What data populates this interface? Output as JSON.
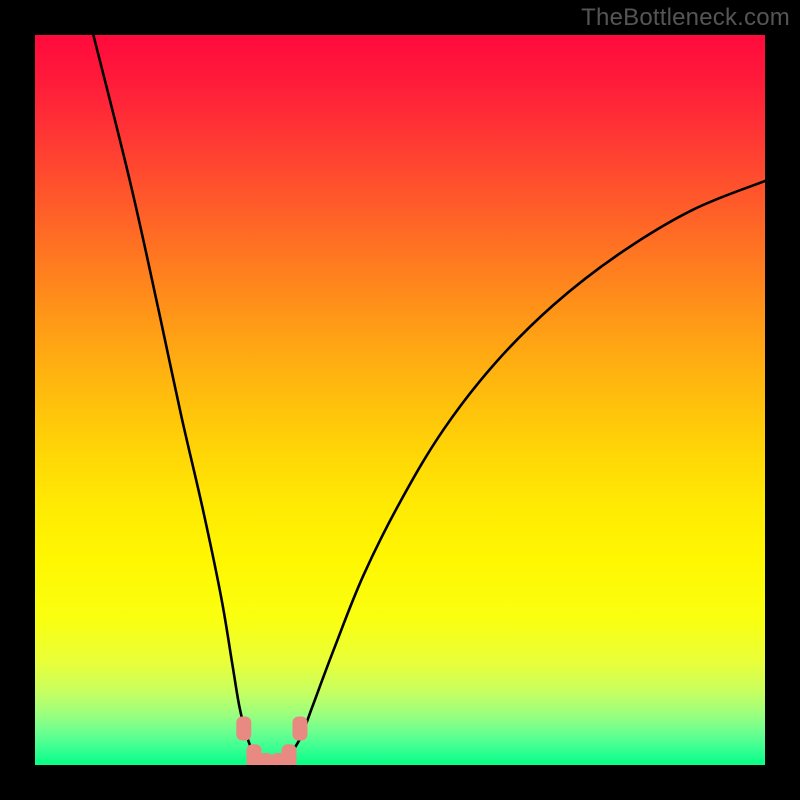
{
  "watermark": "TheBottleneck.com",
  "chart_data": {
    "type": "line",
    "title": "",
    "xlabel": "",
    "ylabel": "",
    "xlim": [
      0,
      100
    ],
    "ylim": [
      0,
      100
    ],
    "grid": false,
    "curve_points": [
      {
        "x": 8.0,
        "y": 100.0
      },
      {
        "x": 13.0,
        "y": 80.0
      },
      {
        "x": 17.0,
        "y": 62.0
      },
      {
        "x": 20.0,
        "y": 48.0
      },
      {
        "x": 23.0,
        "y": 35.0
      },
      {
        "x": 25.5,
        "y": 23.0
      },
      {
        "x": 27.0,
        "y": 14.0
      },
      {
        "x": 28.0,
        "y": 8.0
      },
      {
        "x": 29.0,
        "y": 4.0
      },
      {
        "x": 30.0,
        "y": 1.5
      },
      {
        "x": 31.0,
        "y": 0.3
      },
      {
        "x": 32.5,
        "y": 0.0
      },
      {
        "x": 34.0,
        "y": 0.3
      },
      {
        "x": 35.0,
        "y": 1.5
      },
      {
        "x": 36.5,
        "y": 4.0
      },
      {
        "x": 38.0,
        "y": 8.0
      },
      {
        "x": 41.0,
        "y": 16.0
      },
      {
        "x": 45.0,
        "y": 26.0
      },
      {
        "x": 50.0,
        "y": 36.0
      },
      {
        "x": 56.0,
        "y": 46.0
      },
      {
        "x": 63.0,
        "y": 55.0
      },
      {
        "x": 71.0,
        "y": 63.0
      },
      {
        "x": 80.0,
        "y": 70.0
      },
      {
        "x": 90.0,
        "y": 76.0
      },
      {
        "x": 100.0,
        "y": 80.0
      }
    ],
    "markers": [
      {
        "x": 28.6,
        "y": 5.0
      },
      {
        "x": 30.0,
        "y": 1.2
      },
      {
        "x": 31.6,
        "y": 0.0
      },
      {
        "x": 33.3,
        "y": 0.0
      },
      {
        "x": 34.8,
        "y": 1.2
      },
      {
        "x": 36.3,
        "y": 5.0
      }
    ],
    "gradient_colors": {
      "top": "#ff0a3c",
      "mid": "#fff702",
      "bottom": "#08ff82"
    }
  }
}
